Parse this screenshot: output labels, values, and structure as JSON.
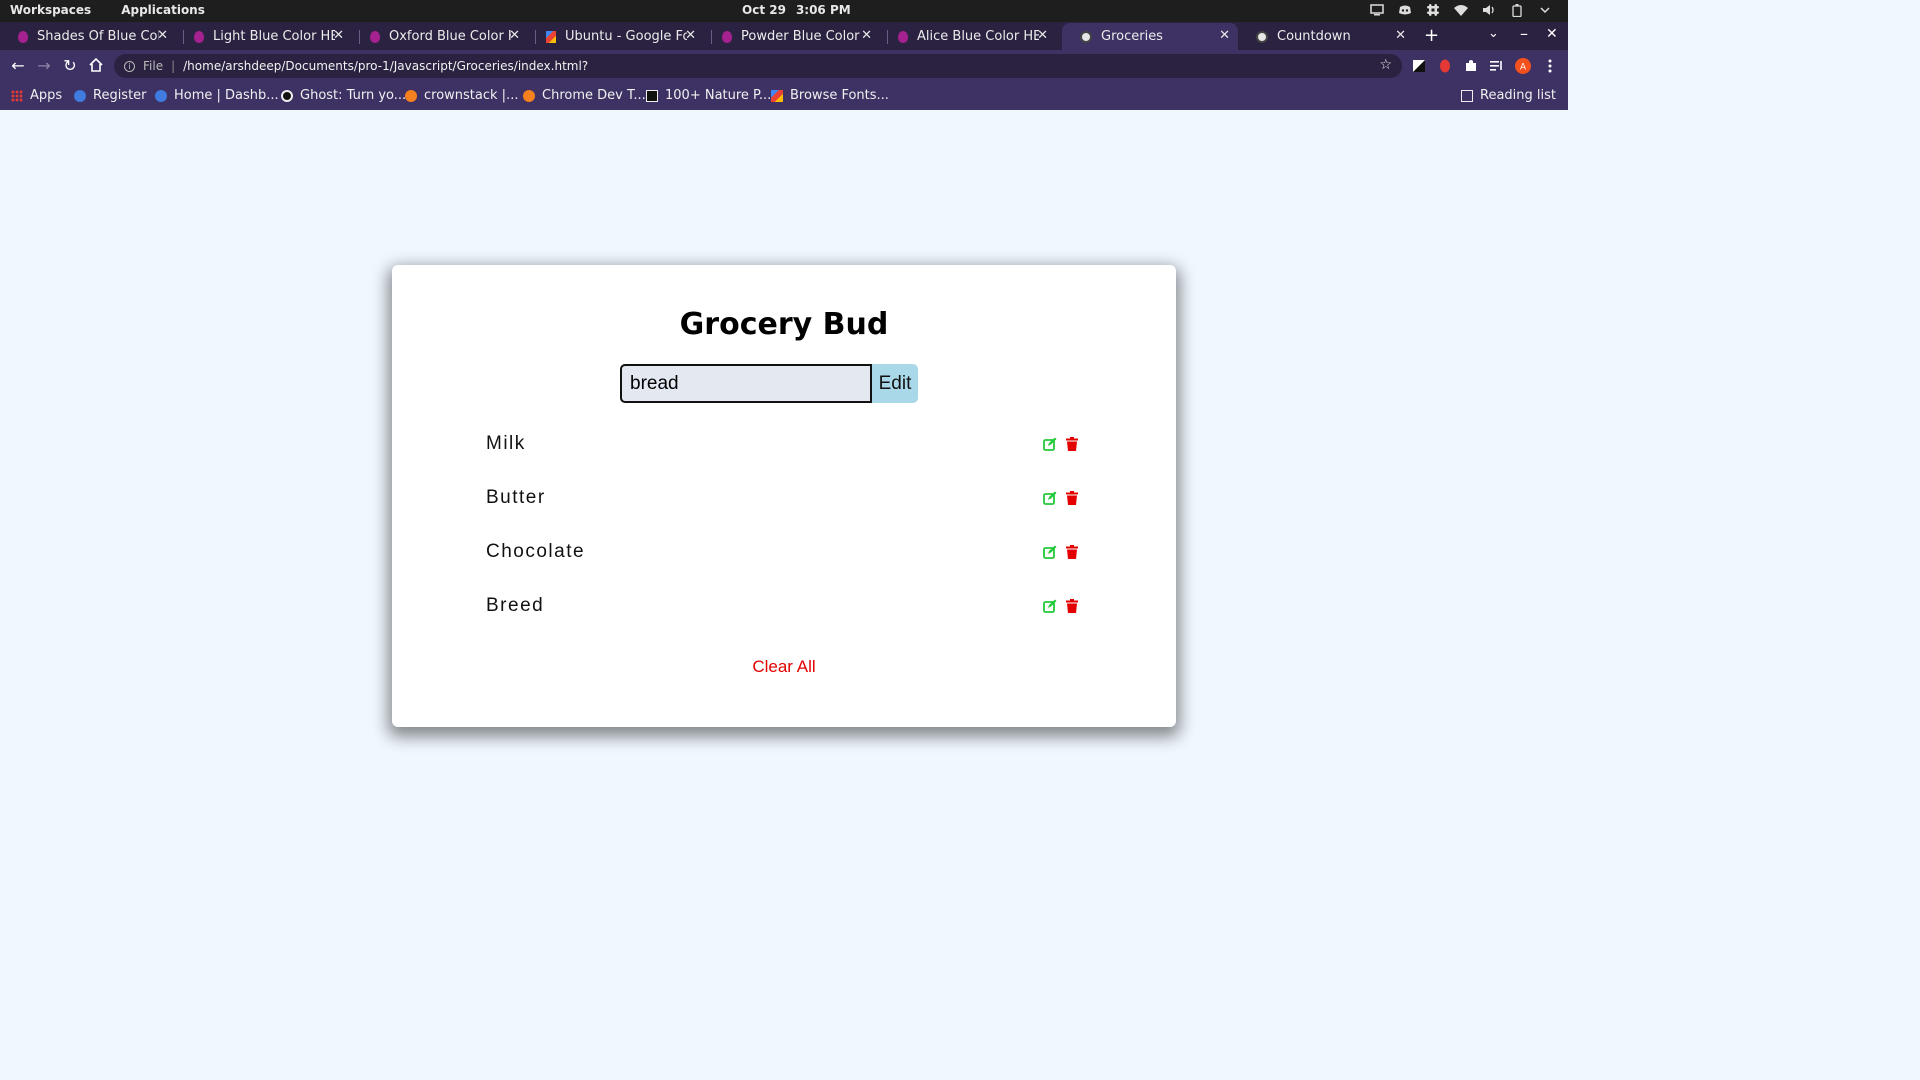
{
  "os": {
    "workspaces": "Workspaces",
    "applications": "Applications",
    "date": "Oct 29",
    "time": "3:06 PM"
  },
  "tabs": [
    {
      "label": "Shades Of Blue Color",
      "active": false
    },
    {
      "label": "Light Blue Color HEX",
      "active": false
    },
    {
      "label": "Oxford Blue Color HE",
      "active": false
    },
    {
      "label": "Ubuntu - Google Font",
      "active": false
    },
    {
      "label": "Powder Blue Color H",
      "active": false
    },
    {
      "label": "Alice Blue Color HEX",
      "active": false
    },
    {
      "label": "Groceries",
      "active": true
    },
    {
      "label": "Countdown",
      "active": false
    }
  ],
  "address": {
    "scheme": "File",
    "url": "/home/arshdeep/Documents/pro-1/Javascript/Groceries/index.html?"
  },
  "bookmarks": {
    "items": [
      "Apps",
      "Register",
      "Home | Dashb...",
      "Ghost: Turn yo...",
      "crownstack |...",
      "Chrome Dev T...",
      "100+ Nature P...",
      "Browse Fonts..."
    ],
    "reading_list": "Reading list"
  },
  "app": {
    "title": "Grocery Bud",
    "input_value": "bread",
    "submit_label": "Edit",
    "items": [
      "Milk",
      "Butter",
      "Chocolate",
      "Breed"
    ],
    "clear_label": "Clear All"
  },
  "colors": {
    "page_bg": "#f0f8ff",
    "edit_icon": "#22c93a",
    "delete_icon": "#e20000",
    "submit_bg": "#a9d8e8",
    "clear_text": "#e20000"
  }
}
